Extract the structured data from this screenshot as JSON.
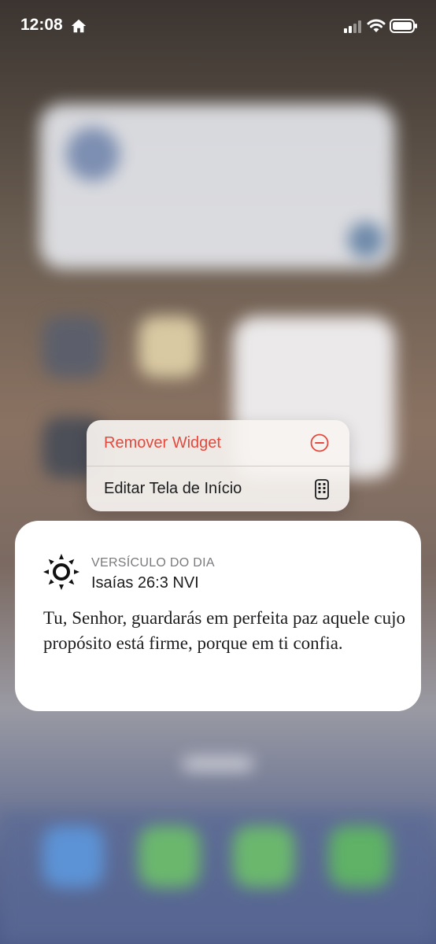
{
  "status_bar": {
    "time": "12:08",
    "icons": [
      "home-icon",
      "cellular-signal-icon",
      "wifi-icon",
      "battery-icon"
    ]
  },
  "context_menu": {
    "remove_label": "Remover Widget",
    "remove_icon": "minus-circle-icon",
    "edit_label": "Editar Tela de Início",
    "edit_icon": "phone-icon",
    "remove_color": "#e5483c"
  },
  "verse_widget": {
    "icon": "sun-icon",
    "kicker": "VERSÍCULO DO DIA",
    "reference": "Isaías 26:3 NVI",
    "text": "Tu, Senhor, guardarás em perfeita paz aquele cujo propósito está firme, porque em ti confia."
  }
}
